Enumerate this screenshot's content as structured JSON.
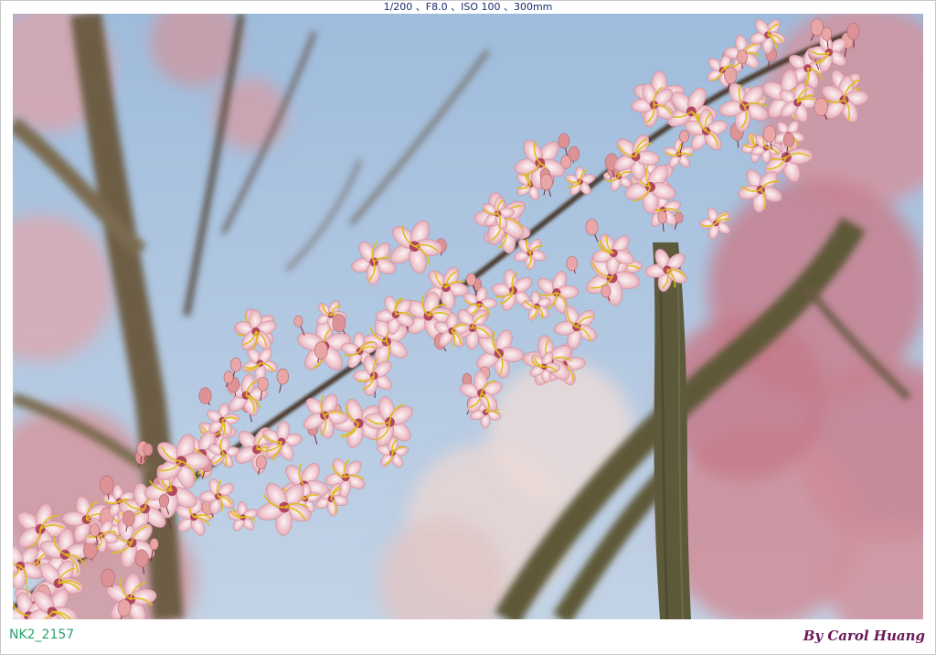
{
  "exif_line": "1/200 、F8.0 、ISO 100 、300mm",
  "photo": {
    "icon": "flowering-branch-photo",
    "colors": {
      "sky": "#a9c3de",
      "bark": "#5b4e34",
      "petal_pink": "#e8a9b6",
      "petal_white": "#f4ecee",
      "stamen_yellow": "#e3c21e",
      "bud": "#d98c8f"
    }
  },
  "footer": {
    "id_label": "NK2_2157",
    "credit": "By Carol Huang"
  }
}
